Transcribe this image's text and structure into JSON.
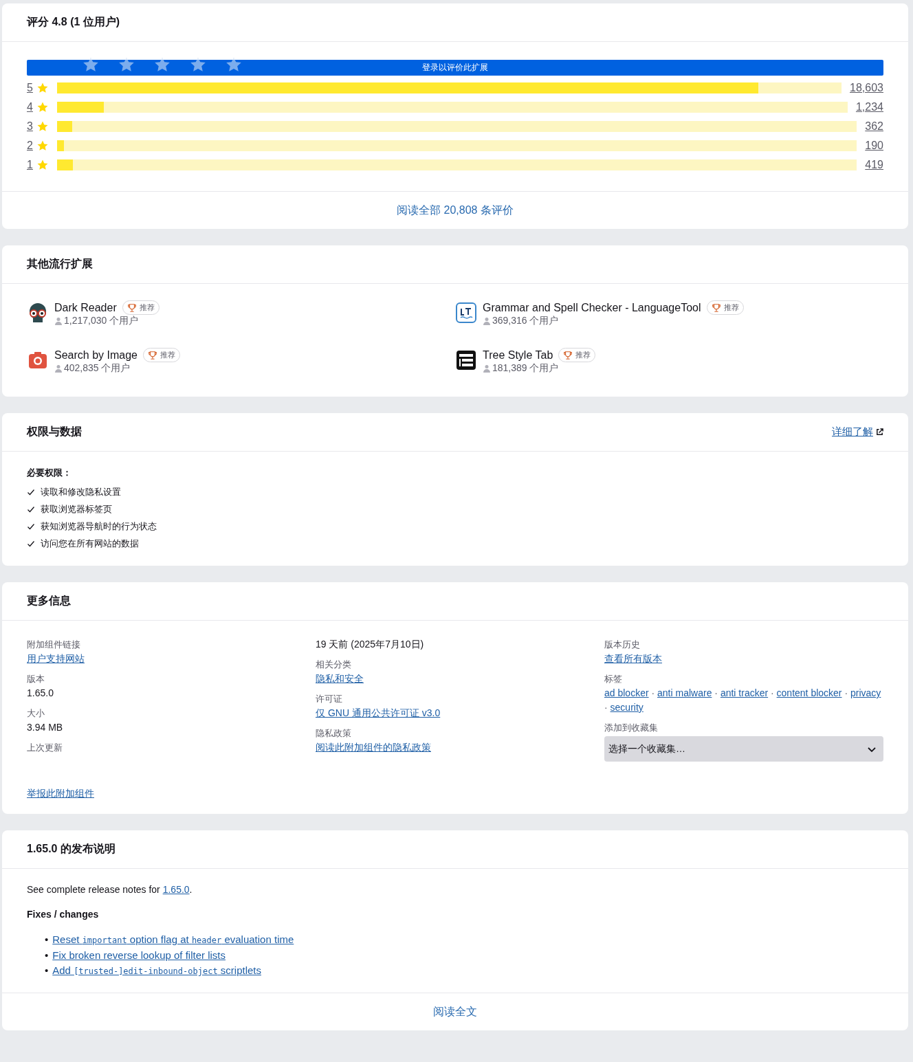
{
  "ratings": {
    "title": "评分 4.8  (1 位用户)",
    "sign_in_button": "登录以评价此扩展",
    "rows": [
      {
        "star": "5",
        "count": "18,603",
        "level": 0.894
      },
      {
        "star": "4",
        "count": "1,234",
        "level": 0.059
      },
      {
        "star": "3",
        "count": "362",
        "level": 0.019
      },
      {
        "star": "2",
        "count": "190",
        "level": 0.009
      },
      {
        "star": "1",
        "count": "419",
        "level": 0.02
      }
    ],
    "read_all_link": "阅读全部 20,808 条评价"
  },
  "popular": {
    "title": "其他流行扩展",
    "items": [
      {
        "name": "Dark Reader",
        "badge": "推荐",
        "users": "1,217,030 个用户"
      },
      {
        "name": "Grammar and Spell Checker - LanguageTool",
        "badge": "推荐",
        "users": "369,316 个用户"
      },
      {
        "name": "Search by Image",
        "badge": "推荐",
        "users": "402,835 个用户"
      },
      {
        "name": "Tree Style Tab",
        "badge": "推荐",
        "users": "181,389 个用户"
      }
    ]
  },
  "permissions": {
    "title": "权限与数据",
    "learn_more_link": "详细了解",
    "required_label": "必要权限：",
    "items": [
      "读取和修改隐私设置",
      "获取浏览器标签页",
      "获知浏览器导航时的行为状态",
      "访问您在所有网站的数据"
    ]
  },
  "more_info": {
    "title": "更多信息",
    "columns": [
      [
        {
          "label": "附加组件链接",
          "value": "用户支持网站",
          "kind": "link"
        },
        {
          "label": "版本",
          "value": "1.65.0",
          "kind": "text"
        },
        {
          "label": "大小",
          "value": "3.94 MB",
          "kind": "text"
        },
        {
          "label": "上次更新",
          "kind": "label"
        }
      ],
      [
        {
          "value": "19 天前 (2025年7月10日)",
          "kind": "text"
        },
        {
          "label": "相关分类",
          "value": "隐私和安全",
          "kind": "link"
        },
        {
          "label": "许可证",
          "value": "仅 GNU 通用公共许可证 v3.0",
          "kind": "link"
        },
        {
          "label": "隐私政策",
          "value": "阅读此附加组件的隐私政策",
          "kind": "link"
        }
      ],
      [
        {
          "label": "版本历史",
          "value": "查看所有版本",
          "kind": "link"
        },
        {
          "label": "标签",
          "tags": [
            {
              "text": "ad blocker",
              "sep": "·"
            },
            {
              "text": "anti malware",
              "sep": "·"
            },
            {
              "text": "anti tracker",
              "sep": "·"
            },
            {
              "text": "content blocker",
              "sep": "·"
            },
            {
              "text": "privacy",
              "sep": "·"
            },
            {
              "text": "security"
            }
          ],
          "kind": "tags"
        },
        {
          "label": "添加到收藏集",
          "value": "选择一个收藏集…",
          "kind": "select"
        }
      ]
    ],
    "report_link": "举报此附加组件"
  },
  "release_notes": {
    "title": "1.65.0 的发布说明",
    "intro": "See complete release notes for ",
    "intro_link": "1.65.0",
    "intro_end": ".",
    "heading": "Fixes / changes",
    "items": [
      {
        "bullet": "•",
        "parts": [
          {
            "kind": "text",
            "text": "Reset "
          },
          {
            "kind": "code",
            "text": "important"
          },
          {
            "kind": "text",
            "text": " option flag at "
          },
          {
            "kind": "code",
            "text": "header"
          },
          {
            "kind": "text",
            "text": " evaluation time"
          }
        ]
      },
      {
        "bullet": "•",
        "parts": [
          {
            "kind": "text",
            "text": "Fix broken reverse lookup of filter lists"
          }
        ]
      },
      {
        "bullet": "•",
        "parts": [
          {
            "kind": "text",
            "text": "Add "
          },
          {
            "kind": "code",
            "text": "[trusted-]edit-inbound-object"
          },
          {
            "kind": "text",
            "text": " scriptlets"
          }
        ]
      }
    ],
    "read_more_link": "阅读全文"
  }
}
